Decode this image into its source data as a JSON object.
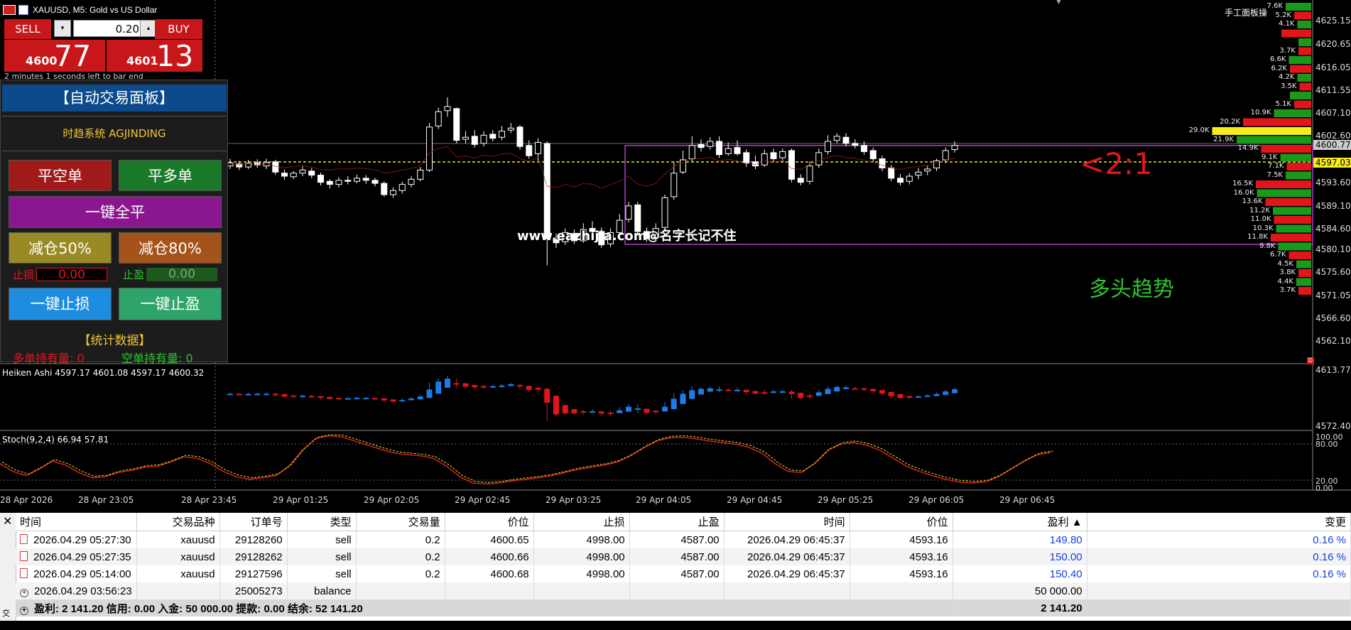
{
  "window": {
    "title": "XAUUSD, M5:  Gold vs US Dollar"
  },
  "colors": {
    "bull": "#ffffff",
    "bear": "#ffffff",
    "ha_up": "#1e7be8",
    "ha_down": "#e0161b",
    "stoch_main": "#d92222",
    "stoch_signal": "#e8e81a",
    "box": "#b040c8",
    "bid_line": "#e8e81a",
    "accent_green": "#2fc32f"
  },
  "trade": {
    "sell_label": "SELL",
    "buy_label": "BUY",
    "lot": "0.20",
    "spin_down": "▾",
    "spin_up": "▴",
    "sell_price_small": "4600",
    "sell_price_big": "77",
    "buy_price_small": "4601",
    "buy_price_big": "13",
    "countdown": "2 minutes 1 seconds left to bar end"
  },
  "panel": {
    "title": "【自动交易面板】",
    "system": "时趋系统 AGJINDING",
    "close_short": "平空单",
    "close_long": "平多单",
    "close_all": "一键全平",
    "reduce50": "减仓50%",
    "reduce80": "减仓80%",
    "sl_label": "止损",
    "sl_value": "0.00",
    "tp_label": "止盈",
    "tp_value": "0.00",
    "one_sl": "一键止损",
    "one_tp": "一键止盈",
    "stats_title": "【统计数据】",
    "long_hold": "多单持有量: 0",
    "short_hold": "空单持有量: 0"
  },
  "chart": {
    "watermark": "www.eazhijia.com@名字长记不住",
    "ratio": "<2:1",
    "trend": "多头趋势",
    "manual_panel": "手工面板操",
    "price_axis": [
      "4625.15",
      "4620.65",
      "4616.05",
      "4611.55",
      "4607.10",
      "4602.60",
      "4593.60",
      "4589.10",
      "4584.60",
      "4580.10",
      "4575.60",
      "4571.05",
      "4566.60",
      "4562.10"
    ],
    "current_price_grey": "4600.77",
    "current_price_yellow": "4597.03",
    "heiken_label": "Heiken Ashi 4597.17 4601.08 4597.17 4600.32",
    "heiken_axis": [
      "4613.77",
      "4572.40"
    ],
    "stoch_label": "Stoch(9,2,4) 66.94 57.81",
    "stoch_axis": [
      "100.00",
      "80.00",
      "20.00",
      "0.00"
    ],
    "time_axis": [
      "28 Apr 2026",
      "28 Apr 23:05",
      "28 Apr 23:45",
      "29 Apr 01:25",
      "29 Apr 02:05",
      "29 Apr 02:45",
      "29 Apr 03:25",
      "29 Apr 04:05",
      "29 Apr 04:45",
      "29 Apr 05:25",
      "29 Apr 06:05",
      "29 Apr 06:45"
    ]
  },
  "depth": [
    {
      "label": "7.6K",
      "side": "ask",
      "size": 0.24
    },
    {
      "label": "5.2K",
      "side": "ask",
      "size": 0.16
    },
    {
      "label": "4.1K",
      "side": "ask",
      "size": 0.13
    },
    {
      "label": "",
      "side": "ask",
      "size": 0.28
    },
    {
      "label": "",
      "side": "ask",
      "size": 0.12
    },
    {
      "label": "3.7K",
      "side": "ask",
      "size": 0.12
    },
    {
      "label": "6.6K",
      "side": "ask",
      "size": 0.21
    },
    {
      "label": "6.2K",
      "side": "ask",
      "size": 0.2
    },
    {
      "label": "4.2K",
      "side": "ask",
      "size": 0.13
    },
    {
      "label": "3.5K",
      "side": "ask",
      "size": 0.11
    },
    {
      "label": "",
      "side": "ask",
      "size": 0.2
    },
    {
      "label": "5.1K",
      "side": "ask",
      "size": 0.16
    },
    {
      "label": "10.9K",
      "side": "ask",
      "size": 0.35
    },
    {
      "label": "20.2K",
      "side": "ask",
      "size": 0.64
    },
    {
      "label": "29.0K",
      "side": "ask",
      "size": 0.93
    },
    {
      "label": "21.9K",
      "side": "bid",
      "size": 0.7
    },
    {
      "label": "14.9K",
      "side": "bid",
      "size": 0.47
    },
    {
      "label": "9.1K",
      "side": "bid",
      "size": 0.29
    },
    {
      "label": "7.1K",
      "side": "bid",
      "size": 0.23
    },
    {
      "label": "7.5K",
      "side": "bid",
      "size": 0.24
    },
    {
      "label": "16.5K",
      "side": "bid",
      "size": 0.52
    },
    {
      "label": "16.0K",
      "side": "bid",
      "size": 0.51
    },
    {
      "label": "13.6K",
      "side": "bid",
      "size": 0.43
    },
    {
      "label": "11.2K",
      "side": "bid",
      "size": 0.36
    },
    {
      "label": "11.0K",
      "side": "bid",
      "size": 0.35
    },
    {
      "label": "10.3K",
      "side": "bid",
      "size": 0.33
    },
    {
      "label": "11.8K",
      "side": "bid",
      "size": 0.38
    },
    {
      "label": "9.8K",
      "side": "bid",
      "size": 0.31
    },
    {
      "label": "6.7K",
      "side": "bid",
      "size": 0.21
    },
    {
      "label": "4.5K",
      "side": "bid",
      "size": 0.14
    },
    {
      "label": "3.8K",
      "side": "bid",
      "size": 0.12
    },
    {
      "label": "4.4K",
      "side": "bid",
      "size": 0.14
    },
    {
      "label": "3.7K",
      "side": "bid",
      "size": 0.12
    }
  ],
  "terminal": {
    "close": "✕",
    "side_label": "交易",
    "headers": [
      "时间",
      "交易品种",
      "订单号",
      "类型",
      "交易量",
      "价位",
      "止损",
      "止盈",
      "时间",
      "价位",
      "盈利 ▲",
      "变更"
    ],
    "rows": [
      [
        "2026.04.29 05:27:30",
        "xauusd",
        "29128260",
        "sell",
        "0.2",
        "4600.65",
        "4998.00",
        "4587.00",
        "2026.04.29 06:45:37",
        "4593.16",
        "149.80",
        "0.16 %"
      ],
      [
        "2026.04.29 05:27:35",
        "xauusd",
        "29128262",
        "sell",
        "0.2",
        "4600.66",
        "4998.00",
        "4587.00",
        "2026.04.29 06:45:37",
        "4593.16",
        "150.00",
        "0.16 %"
      ],
      [
        "2026.04.29 05:14:00",
        "xauusd",
        "29127596",
        "sell",
        "0.2",
        "4600.68",
        "4998.00",
        "4587.00",
        "2026.04.29 06:45:37",
        "4593.16",
        "150.40",
        "0.16 %"
      ]
    ],
    "balance": {
      "time": "2026.04.29 03:56:23",
      "order": "25005273",
      "type": "balance",
      "profit": "50 000.00"
    },
    "footer": {
      "summary": "盈利: 2 141.20  信用: 0.00  入金: 50 000.00  提款: 0.00  结余: 52 141.20",
      "total": "2 141.20"
    }
  }
}
